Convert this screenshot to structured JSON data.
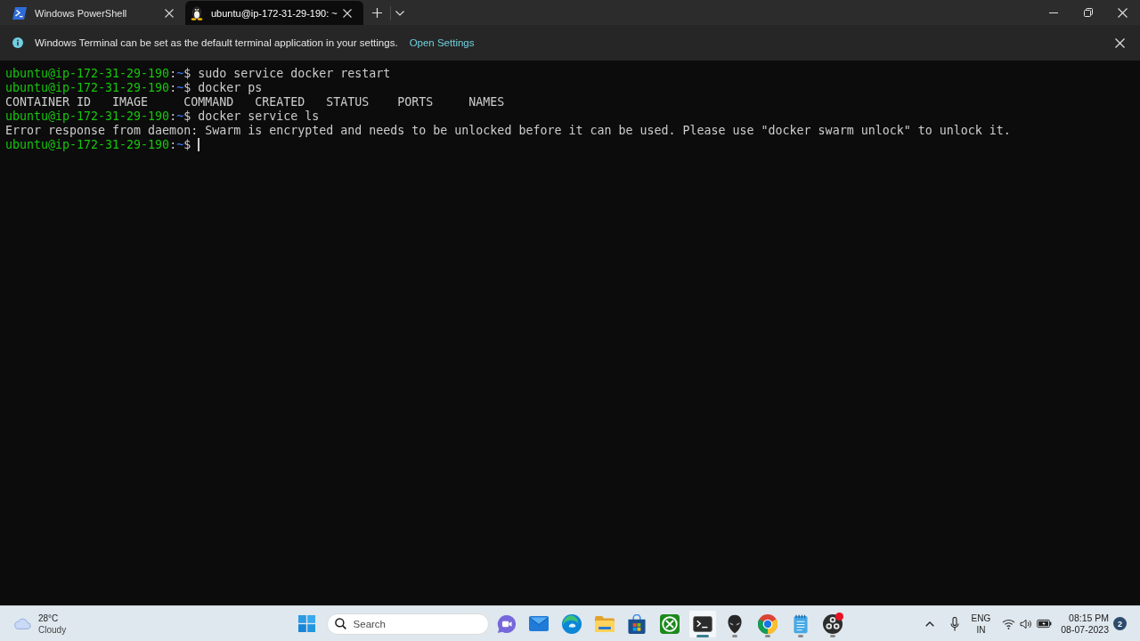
{
  "window": {
    "tabs": [
      {
        "kind": "powershell",
        "title": "Windows PowerShell",
        "selected": false
      },
      {
        "kind": "linux",
        "title": "ubuntu@ip-172-31-29-190: ~",
        "selected": true
      }
    ]
  },
  "infobar": {
    "message": "Windows Terminal can be set as the default terminal application in your settings.",
    "link": "Open Settings"
  },
  "terminal": {
    "lines": [
      {
        "kind": "prompt",
        "user_host": "ubuntu@ip-172-31-29-190",
        "separator": ":",
        "path": "~",
        "symbol": "$",
        "command": "sudo service docker restart"
      },
      {
        "kind": "prompt",
        "user_host": "ubuntu@ip-172-31-29-190",
        "separator": ":",
        "path": "~",
        "symbol": "$",
        "command": "docker ps"
      },
      {
        "kind": "output",
        "text": "CONTAINER ID   IMAGE     COMMAND   CREATED   STATUS    PORTS     NAMES"
      },
      {
        "kind": "prompt",
        "user_host": "ubuntu@ip-172-31-29-190",
        "separator": ":",
        "path": "~",
        "symbol": "$",
        "command": "docker service ls"
      },
      {
        "kind": "output",
        "text": "Error response from daemon: Swarm is encrypted and needs to be unlocked before it can be used. Please use \"docker swarm unlock\" to unlock it."
      },
      {
        "kind": "prompt",
        "user_host": "ubuntu@ip-172-31-29-190",
        "separator": ":",
        "path": "~",
        "symbol": "$"
      }
    ],
    "cursor": true
  },
  "taskbar": {
    "weather": {
      "temperature": "28°C",
      "condition": "Cloudy"
    },
    "search": {
      "placeholder": "Search"
    },
    "apps": [
      {
        "kind": "chat",
        "selected": false,
        "running": false,
        "alert": false
      },
      {
        "kind": "mail",
        "selected": false,
        "running": false,
        "alert": false
      },
      {
        "kind": "edge",
        "selected": false,
        "running": false,
        "alert": false
      },
      {
        "kind": "files",
        "selected": false,
        "running": false,
        "alert": false
      },
      {
        "kind": "store",
        "selected": false,
        "running": false,
        "alert": false
      },
      {
        "kind": "xbox",
        "selected": false,
        "running": false,
        "alert": false
      },
      {
        "kind": "terminal",
        "selected": true,
        "running": true,
        "alert": false
      },
      {
        "kind": "alien",
        "selected": false,
        "running": true,
        "alert": false
      },
      {
        "kind": "chrome",
        "selected": false,
        "running": true,
        "alert": false
      },
      {
        "kind": "notepad",
        "selected": false,
        "running": true,
        "alert": false
      },
      {
        "kind": "obs",
        "selected": false,
        "running": true,
        "alert": true
      }
    ],
    "tray": {
      "language": "ENG",
      "region": "IN",
      "time": "08:15 PM",
      "date": "08-07-2023",
      "notifications": "2"
    }
  }
}
